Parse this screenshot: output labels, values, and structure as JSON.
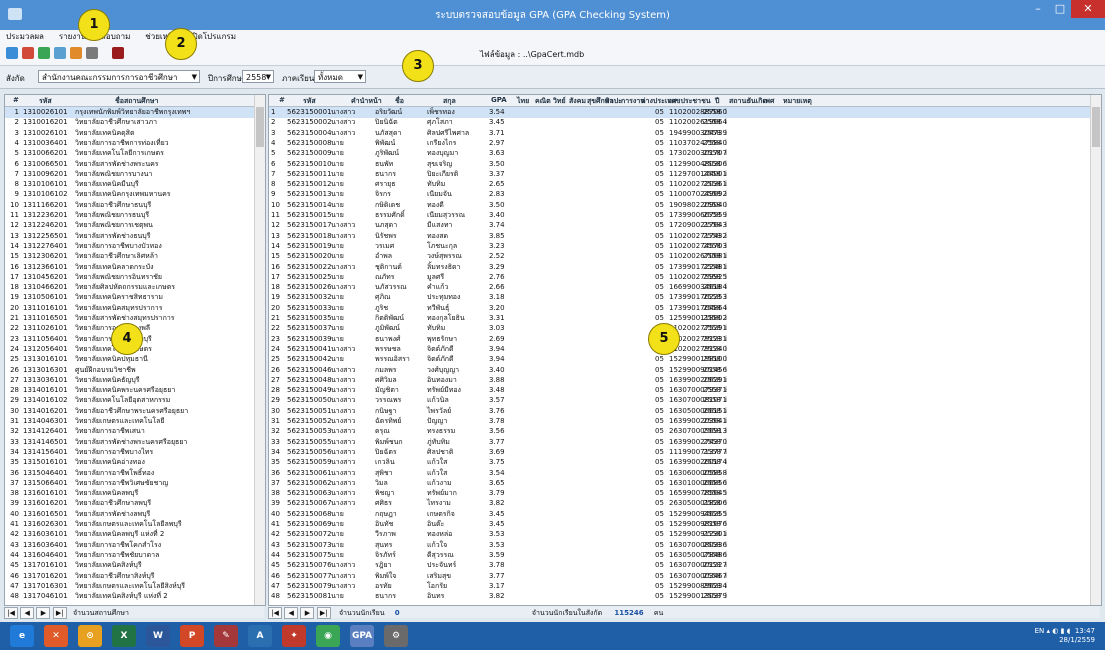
{
  "window": {
    "title": "ระบบตรวจสอบข้อมูล GPA (GPA Checking System)",
    "min": "–",
    "max": "□",
    "close": "✕"
  },
  "menu": [
    "ประมวลผล",
    "รายงาน",
    "สอบถาม",
    "ช่วยเหลือ",
    "ปิดโปรแกรม"
  ],
  "toolbar": {
    "path_label": "ไฟล์ข้อมูล : ..\\GpaCert.mdb"
  },
  "filters": {
    "school_label": "สังกัด",
    "school_value": "สำนักงานคณะกรรมการการอาชีวศึกษา",
    "year_label": "ปีการศึกษา",
    "year_value": "2558",
    "term_label": "ภาคเรียน",
    "term_value": "ทั้งหมด"
  },
  "left_grid": {
    "headers": [
      "#",
      "รหัส",
      "ชื่อสถานศึกษา"
    ],
    "rows": [
      [
        "1",
        "1310026101",
        "กรุงเทพนักพิมพ์วิทยาลัยอาชีพกรุงเทพฯ"
      ],
      [
        "2",
        "1310016201",
        "วิทยาลัยอาชีวศึกษาเสาวภา"
      ],
      [
        "3",
        "1310026101",
        "วิทยาลัยเทคนิคดุสิต"
      ],
      [
        "4",
        "1310036401",
        "วิทยาลัยการอาชีพการท่องเที่ยว"
      ],
      [
        "5",
        "1310066201",
        "วิทยาลัยเทคโนโลยีการเกษตร"
      ],
      [
        "6",
        "1310066501",
        "วิทยาลัยสารพัดช่างพระนคร"
      ],
      [
        "7",
        "1310096201",
        "วิทยาลัยพณิชยการบางนา"
      ],
      [
        "8",
        "1310106101",
        "วิทยาลัยเทคนิคมีนบุรี"
      ],
      [
        "9",
        "1310106102",
        "วิทยาลัยเทคนิคกรุงเทพมหานคร"
      ],
      [
        "10",
        "1311166201",
        "วิทยาลัยอาชีวศึกษาธนบุรี"
      ],
      [
        "11",
        "1312236201",
        "วิทยาลัยพณิชยการธนบุรี"
      ],
      [
        "12",
        "1312246201",
        "วิทยาลัยพณิชยการเชตุพน"
      ],
      [
        "13",
        "1312256501",
        "วิทยาลัยสารพัดช่างธนบุรี"
      ],
      [
        "14",
        "1312276401",
        "วิทยาลัยการอาชีพบางบัวทอง"
      ],
      [
        "15",
        "1312306201",
        "วิทยาลัยอาชีวศึกษาเลิศหล้า"
      ],
      [
        "16",
        "1312366101",
        "วิทยาลัยเทคนิคลาดกระบัง"
      ],
      [
        "17",
        "1310456201",
        "วิทยาลัยพณิชยการอินทราชัย"
      ],
      [
        "18",
        "1310466201",
        "วิทยาลัยศิลปหัตถกรรมและเกษตร"
      ],
      [
        "19",
        "1310506101",
        "วิทยาลัยเทคนิคราชสิทธาราม"
      ],
      [
        "20",
        "1311016101",
        "วิทยาลัยเทคนิคสมุทรปราการ"
      ],
      [
        "21",
        "1311016501",
        "วิทยาลัยสารพัดช่างสมุทรปราการ"
      ],
      [
        "22",
        "1311026101",
        "วิทยาลัยการอาชีพบางพลี"
      ],
      [
        "23",
        "1311056401",
        "วิทยาลัยการอาชีพนนทบุรี"
      ],
      [
        "24",
        "1312056401",
        "วิทยาลัยเทคโนโลยีเกษตร"
      ],
      [
        "25",
        "1313016101",
        "วิทยาลัยเทคนิคปทุมธานี"
      ],
      [
        "26",
        "1313016301",
        "ศูนย์ฝึกอบรมวิชาชีพ"
      ],
      [
        "27",
        "1313036101",
        "วิทยาลัยเทคนิคธัญบุรี"
      ],
      [
        "28",
        "1314016101",
        "วิทยาลัยเทคนิคพระนครศรีอยุธยา"
      ],
      [
        "29",
        "1314016102",
        "วิทยาลัยเทคโนโลยีอุตสาหกรรม"
      ],
      [
        "30",
        "1314016201",
        "วิทยาลัยอาชีวศึกษาพระนครศรีอยุธยา"
      ],
      [
        "31",
        "1314046301",
        "วิทยาลัยเกษตรและเทคโนโลยี"
      ],
      [
        "32",
        "1314126401",
        "วิทยาลัยการอาชีพเสนา"
      ],
      [
        "33",
        "1314146501",
        "วิทยาลัยสารพัดช่างพระนครศรีอยุธยา"
      ],
      [
        "34",
        "1314156401",
        "วิทยาลัยการอาชีพบางไทร"
      ],
      [
        "35",
        "1315016101",
        "วิทยาลัยเทคนิคอ่างทอง"
      ],
      [
        "36",
        "1315046401",
        "วิทยาลัยการอาชีพโพธิ์ทอง"
      ],
      [
        "37",
        "1315066401",
        "วิทยาลัยการอาชีพวิเศษชัยชาญ"
      ],
      [
        "38",
        "1316016101",
        "วิทยาลัยเทคนิคลพบุรี"
      ],
      [
        "39",
        "1316016201",
        "วิทยาลัยอาชีวศึกษาลพบุรี"
      ],
      [
        "40",
        "1316016501",
        "วิทยาลัยสารพัดช่างลพบุรี"
      ],
      [
        "41",
        "1316026301",
        "วิทยาลัยเกษตรและเทคโนโลยีลพบุรี"
      ],
      [
        "42",
        "1316036101",
        "วิทยาลัยเทคนิคลพบุรี แห่งที่ 2"
      ],
      [
        "43",
        "1316036401",
        "วิทยาลัยการอาชีพโคกสำโรง"
      ],
      [
        "44",
        "1316046401",
        "วิทยาลัยการอาชีพชัยบาดาล"
      ],
      [
        "45",
        "1317016101",
        "วิทยาลัยเทคนิคสิงห์บุรี"
      ],
      [
        "46",
        "1317016201",
        "วิทยาลัยอาชีวศึกษาสิงห์บุรี"
      ],
      [
        "47",
        "1317016301",
        "วิทยาลัยเกษตรและเทคโนโลยีสิงห์บุรี"
      ],
      [
        "48",
        "1317046101",
        "วิทยาลัยเทคนิคสิงห์บุรี แห่งที่ 2"
      ]
    ]
  },
  "right_grid": {
    "headers": [
      "#",
      "รหัส",
      "คำนำหน้า",
      "ชื่อ",
      "สกุล",
      "GPA",
      "ไทย",
      "คณิต",
      "วิทย์",
      "สังคม",
      "สุขศึกษา",
      "ศิลปะ",
      "การงาน",
      "ต่างประเทศ",
      "เลขประชาชน",
      "ปี",
      "สถานะ",
      "วันเกิด",
      "เพศ",
      "หมายเหตุ"
    ],
    "rows": [
      [
        "1",
        "5623150001",
        "นางสาว",
        "อริยวัฒน์",
        "เพ็ชรทอง",
        "3.54",
        "1102002887060",
        "2558"
      ],
      [
        "2",
        "5623150002",
        "นางสาว",
        "ปิยนิฉัต",
        "ศุภโสภา",
        "3.45",
        "1102002619664",
        "2558"
      ],
      [
        "3",
        "5623150004",
        "นางสาว",
        "นภัสสุดา",
        "ศิลปศรีไพศาล",
        "3.71",
        "1949900304739",
        "2558"
      ],
      [
        "4",
        "5623150008",
        "นาย",
        "พิพัฒน์",
        "เกรียงไกร",
        "2.97",
        "1103702475840",
        "2558"
      ],
      [
        "5",
        "5623150009",
        "นาย",
        "ภูริพัฒน์",
        "ทองบุญมา",
        "3.63",
        "1730200301707",
        "2558"
      ],
      [
        "6",
        "5623150010",
        "นาย",
        "ธนพัท",
        "สุขเจริญ",
        "3.50",
        "1129900480306",
        "2558"
      ],
      [
        "7",
        "5623150011",
        "นาย",
        "ธนากร",
        "ปิยะเกียรติ",
        "3.37",
        "1129700144001",
        "2558"
      ],
      [
        "8",
        "5623150012",
        "นาย",
        "ศรายุธ",
        "ทับทิม",
        "2.65",
        "1102002720361",
        "2558"
      ],
      [
        "9",
        "5623150013",
        "นาย",
        "จิรกร",
        "เนียมจัน",
        "2.83",
        "1100070249692",
        "2558"
      ],
      [
        "10",
        "5623150014",
        "นาย",
        "กษิดิเดช",
        "ทองดี",
        "3.50",
        "1909802209040",
        "2558"
      ],
      [
        "11",
        "5623150015",
        "นาย",
        "ธรรมศักดิ์",
        "เนียมสุวรรณ",
        "3.40",
        "1739900667559",
        "2558"
      ],
      [
        "12",
        "5623150017",
        "นางสาว",
        "นภสุดา",
        "มีแสงทา",
        "3.74",
        "1720900217643",
        "2558"
      ],
      [
        "13",
        "5623150018",
        "นางสาว",
        "นิรัชพร",
        "ทองสด",
        "3.85",
        "1102002717432",
        "2558"
      ],
      [
        "14",
        "5623150019",
        "นาย",
        "วรเมศ",
        "โภชนะกุล",
        "3.23",
        "1102002745703",
        "2558"
      ],
      [
        "15",
        "5623150020",
        "นาย",
        "อำพล",
        "วงษ์สุพรรณ",
        "2.52",
        "1102002670681",
        "2558"
      ],
      [
        "16",
        "5623150022",
        "นางสาว",
        "ชุติกานต์",
        "ลิ้มทรงธิดา",
        "3.29",
        "1739901722481",
        "2558"
      ],
      [
        "17",
        "5623150025",
        "นาย",
        "ณภัทร",
        "มูลศรี",
        "2.76",
        "1102002759925",
        "2558"
      ],
      [
        "18",
        "5623150026",
        "นางสาว",
        "นภัสวรรณ",
        "คำแก้ว",
        "2.66",
        "1669900346184",
        "2558"
      ],
      [
        "19",
        "5623150032",
        "นาย",
        "ศุภิณ",
        "ประทุมทอง",
        "3.18",
        "1739901762253",
        "2558"
      ],
      [
        "20",
        "5623150033",
        "นาย",
        "ภูริช",
        "ทวีพันธุ์",
        "3.20",
        "1739901764864",
        "2558"
      ],
      [
        "21",
        "5623150035",
        "นาย",
        "กิตติพัฒน์",
        "ทองกุลโยธิน",
        "3.31",
        "1259900118802",
        "2558"
      ],
      [
        "22",
        "5623150037",
        "นาย",
        "ภูมิพัฒน์",
        "ทับทิม",
        "3.03",
        "1102002775291",
        "2558"
      ],
      [
        "23",
        "5623150039",
        "นาย",
        "ธนาพงศ์",
        "พุทธรักษา",
        "2.69",
        "1102002791231",
        "2558"
      ],
      [
        "24",
        "5623150041",
        "นางสาว",
        "พรรษชล",
        "จิตต์ภักดี",
        "3.94",
        "1102002791240",
        "2558"
      ],
      [
        "25",
        "5623150042",
        "นาย",
        "พรรณอิสรา",
        "จิตต์ภักดี",
        "3.94",
        "1529900198100",
        "2558"
      ],
      [
        "26",
        "5623150046",
        "นางสาว",
        "กมลพร",
        "วงศ์บุญญา",
        "3.40",
        "1529900901456",
        "2558"
      ],
      [
        "27",
        "5623150048",
        "นางสาว",
        "ศศิวิมล",
        "อินทองมา",
        "3.88",
        "1639900206291",
        "2558"
      ],
      [
        "28",
        "5623150049",
        "นางสาว",
        "มัญชิตา",
        "ทรัพย์มีทอง",
        "3.48",
        "1630700079371",
        "2558"
      ],
      [
        "29",
        "5623150050",
        "นางสาว",
        "วรรณพร",
        "แก้วนิล",
        "3.57",
        "1630700081071",
        "2558"
      ],
      [
        "30",
        "5623150051",
        "นางสาว",
        "กนิษฐา",
        "ไพรวัลย์",
        "3.76",
        "1630500066151",
        "2558"
      ],
      [
        "31",
        "5623150052",
        "นางสาว",
        "ฉัตรทิพย์",
        "ปัญญา",
        "3.78",
        "1639900203641",
        "2558"
      ],
      [
        "32",
        "5623150053",
        "นางสาว",
        "ดรุณ",
        "ทรงธรรม",
        "3.56",
        "2630700056913",
        "2558"
      ],
      [
        "33",
        "5623150055",
        "นางสาว",
        "พิมพ์ชนก",
        "ภู่ทับทิม",
        "3.77",
        "1639900274370",
        "2558"
      ],
      [
        "34",
        "5623150056",
        "นางสาว",
        "ปิยฉัตร",
        "ศิลปชาติ",
        "3.69",
        "1119900713777",
        "2558"
      ],
      [
        "35",
        "5623150059",
        "นางสาว",
        "เกวลิน",
        "แก้วใส",
        "3.75",
        "1639900260174",
        "2558"
      ],
      [
        "36",
        "5623150061",
        "นางสาว",
        "สุพิชา",
        "แก้วใส",
        "3.54",
        "1630600005858",
        "2558"
      ],
      [
        "37",
        "5623150062",
        "นางสาว",
        "วิมล",
        "แก้วงาม",
        "3.65",
        "1630100066856",
        "2558"
      ],
      [
        "38",
        "5623150063",
        "นางสาว",
        "พิชญา",
        "ทรัพย์มาก",
        "3.79",
        "1659900785645",
        "2558"
      ],
      [
        "39",
        "5623150067",
        "นางสาว",
        "ศศิธร",
        "ไทรงาม",
        "3.82",
        "2630500018206",
        "2558"
      ],
      [
        "40",
        "5623150068",
        "นาย",
        "กฤษฎา",
        "เกษตรกิจ",
        "3.45",
        "1529900946255",
        "2558"
      ],
      [
        "41",
        "5623150069",
        "นาย",
        "อินทัช",
        "อินต๊ะ",
        "3.45",
        "1529900981676",
        "2558"
      ],
      [
        "42",
        "5623150072",
        "นาย",
        "วีรภาพ",
        "ทองหล่อ",
        "3.53",
        "1529900912301",
        "2558"
      ],
      [
        "43",
        "5623150073",
        "นาย",
        "สุนทร",
        "แก้วใจ",
        "3.53",
        "1630700080336",
        "2558"
      ],
      [
        "44",
        "5623150075",
        "นาย",
        "จิรภัทร์",
        "ดีสุวรรณ",
        "3.59",
        "1630500078486",
        "2558"
      ],
      [
        "45",
        "5623150076",
        "นางสาว",
        "รฎิยา",
        "ประจันทร์",
        "3.78",
        "1630700001227",
        "2558"
      ],
      [
        "46",
        "5623150077",
        "นางสาว",
        "พิมพ์ใจ",
        "เสริมสุข",
        "3.77",
        "1630700003467",
        "2558"
      ],
      [
        "47",
        "5623150079",
        "นางสาว",
        "อรทัย",
        "โอกรัย",
        "3.17",
        "1529900896234",
        "2558"
      ],
      [
        "48",
        "5623150081",
        "นาย",
        "ธนากร",
        "อินทร",
        "3.82",
        "1529900130379",
        "2558"
      ]
    ],
    "term_code": "05",
    "status": "i"
  },
  "left_nav": {
    "label": "จำนวนสถานศึกษา"
  },
  "right_nav": {
    "label_count": "จำนวนนักเรียน",
    "count": "0",
    "label_total": "จำนวนนักเรียนในสังกัด",
    "total": "115246",
    "unit": "คน"
  },
  "taskbar": {
    "apps": [
      "e",
      "✕",
      "⊙",
      "X",
      "W",
      "P",
      "✎",
      "A",
      "✦",
      "◉",
      "GPA",
      "⚙"
    ],
    "tray_lang": "EN",
    "time": "13:47",
    "date": "28/1/2559"
  },
  "callouts": [
    "1",
    "2",
    "3",
    "4",
    "5"
  ]
}
